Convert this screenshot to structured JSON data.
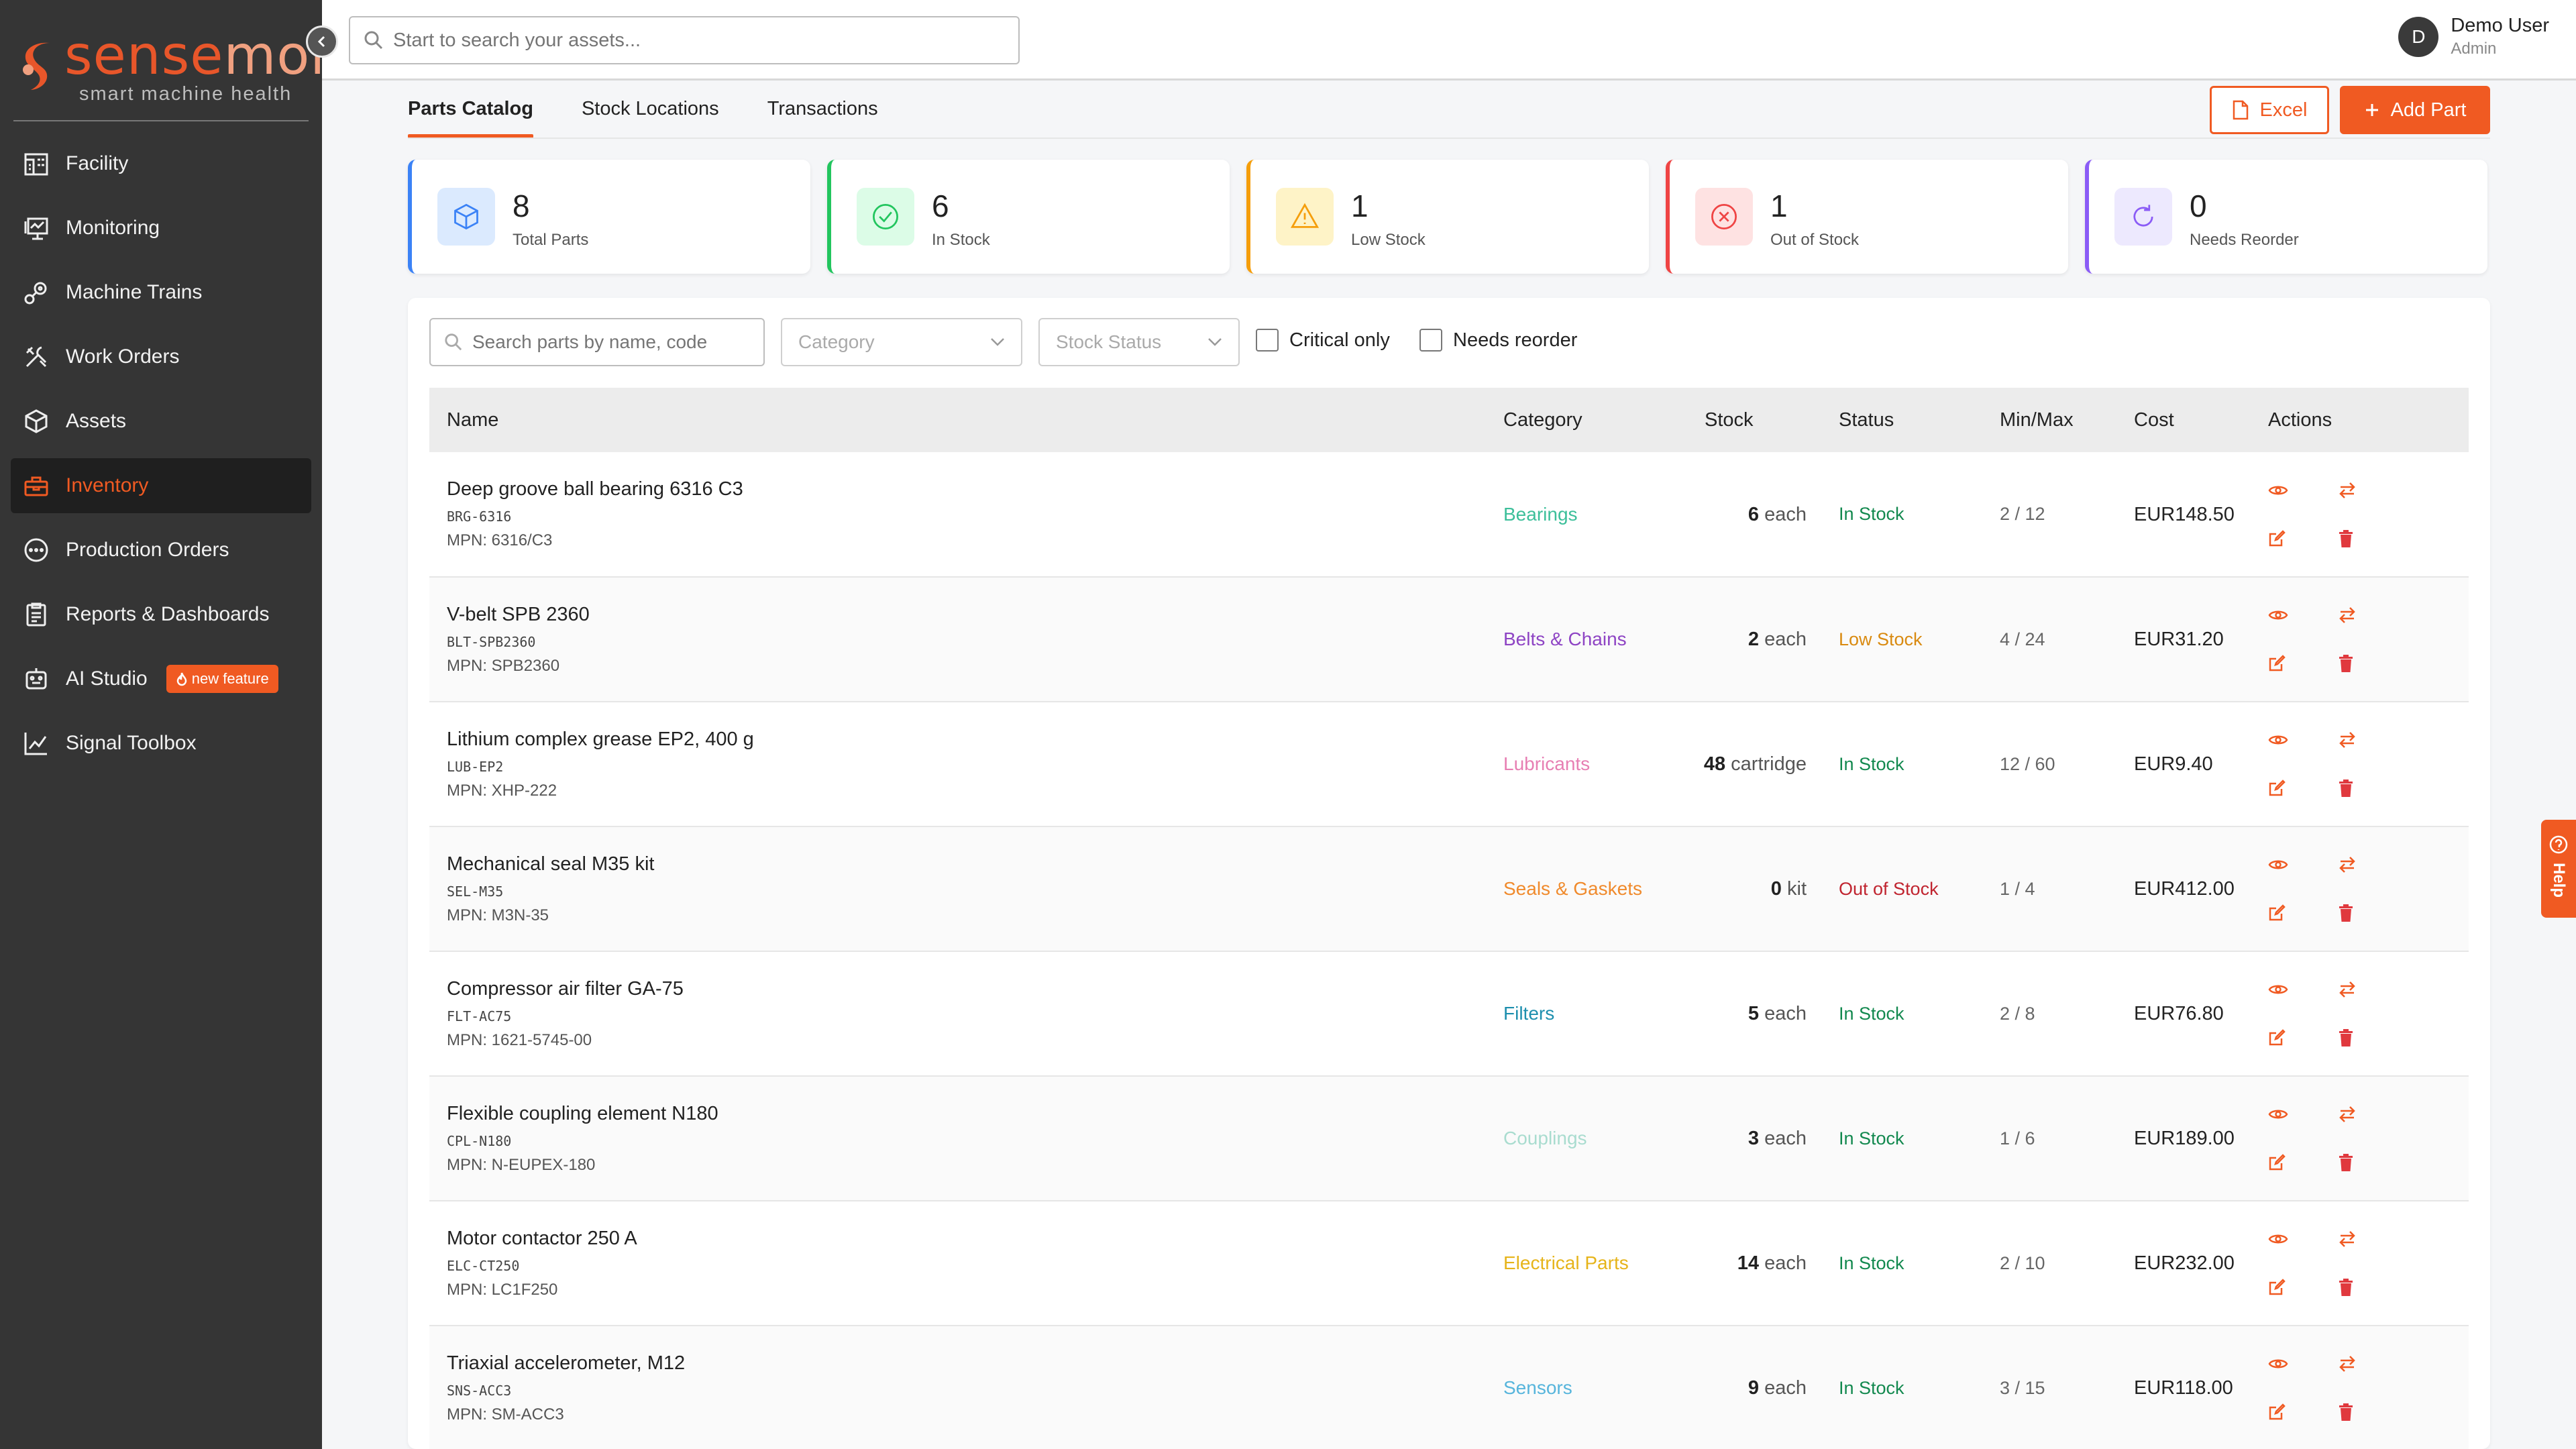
{
  "brand": {
    "word_a": "sense",
    "word_b": "more",
    "tagline": "smart machine health"
  },
  "search": {
    "placeholder": "Start to search your assets..."
  },
  "user": {
    "initial": "D",
    "name": "Demo User",
    "role": "Admin"
  },
  "sidebar": {
    "items": [
      {
        "label": "Facility",
        "icon": "building-icon"
      },
      {
        "label": "Monitoring",
        "icon": "monitor-icon"
      },
      {
        "label": "Machine Trains",
        "icon": "gears-icon"
      },
      {
        "label": "Work Orders",
        "icon": "tools-icon"
      },
      {
        "label": "Assets",
        "icon": "cube-icon"
      },
      {
        "label": "Inventory",
        "icon": "toolbox-icon",
        "active": true
      },
      {
        "label": "Production Orders",
        "icon": "dots-circle-icon"
      },
      {
        "label": "Reports & Dashboards",
        "icon": "clipboard-icon"
      },
      {
        "label": "AI Studio",
        "icon": "robot-icon",
        "badge": "new feature"
      },
      {
        "label": "Signal Toolbox",
        "icon": "chart-line-icon"
      }
    ]
  },
  "tabs": [
    {
      "label": "Parts Catalog",
      "active": true
    },
    {
      "label": "Stock Locations"
    },
    {
      "label": "Transactions"
    }
  ],
  "toolbar": {
    "excel_label": "Excel",
    "add_label": "Add Part"
  },
  "stats": [
    {
      "value": "8",
      "label": "Total Parts",
      "color": "#3b82f6"
    },
    {
      "value": "6",
      "label": "In Stock",
      "color": "#22c55e"
    },
    {
      "value": "1",
      "label": "Low Stock",
      "color": "#f59e0b"
    },
    {
      "value": "1",
      "label": "Out of Stock",
      "color": "#ef4444"
    },
    {
      "value": "0",
      "label": "Needs Reorder",
      "color": "#8b5cf6"
    }
  ],
  "filters": {
    "search_placeholder": "Search parts by name, code",
    "category_placeholder": "Category",
    "status_placeholder": "Stock Status",
    "critical_label": "Critical only",
    "reorder_label": "Needs reorder"
  },
  "table": {
    "headers": {
      "name": "Name",
      "category": "Category",
      "stock": "Stock",
      "status": "Status",
      "minmax": "Min/Max",
      "cost": "Cost",
      "actions": "Actions"
    },
    "rows": [
      {
        "name": "Deep groove ball bearing 6316 C3",
        "code": "BRG-6316",
        "mpn": "MPN: 6316/C3",
        "category": "Bearings",
        "category_color": "#3cbf9a",
        "stock_qty": "6",
        "stock_unit": "each",
        "status": "In Stock",
        "status_color": "#13894f",
        "minmax": "2 / 12",
        "cost": "EUR148.50"
      },
      {
        "name": "V-belt SPB 2360",
        "code": "BLT-SPB2360",
        "mpn": "MPN: SPB2360",
        "category": "Belts & Chains",
        "category_color": "#8e44c4",
        "stock_qty": "2",
        "stock_unit": "each",
        "status": "Low Stock",
        "status_color": "#d98a10",
        "minmax": "4 / 24",
        "cost": "EUR31.20"
      },
      {
        "name": "Lithium complex grease EP2, 400 g",
        "code": "LUB-EP2",
        "mpn": "MPN: XHP-222",
        "category": "Lubricants",
        "category_color": "#e77fb3",
        "stock_qty": "48",
        "stock_unit": "cartridge",
        "status": "In Stock",
        "status_color": "#13894f",
        "minmax": "12 / 60",
        "cost": "EUR9.40"
      },
      {
        "name": "Mechanical seal M35 kit",
        "code": "SEL-M35",
        "mpn": "MPN: M3N-35",
        "category": "Seals & Gaskets",
        "category_color": "#f08a2c",
        "stock_qty": "0",
        "stock_unit": "kit",
        "status": "Out of Stock",
        "status_color": "#c0242f",
        "minmax": "1 / 4",
        "cost": "EUR412.00"
      },
      {
        "name": "Compressor air filter GA-75",
        "code": "FLT-AC75",
        "mpn": "MPN: 1621-5745-00",
        "category": "Filters",
        "category_color": "#1d8fae",
        "stock_qty": "5",
        "stock_unit": "each",
        "status": "In Stock",
        "status_color": "#13894f",
        "minmax": "2 / 8",
        "cost": "EUR76.80"
      },
      {
        "name": "Flexible coupling element N180",
        "code": "CPL-N180",
        "mpn": "MPN: N-EUPEX-180",
        "category": "Couplings",
        "category_color": "#a9dccf",
        "stock_qty": "3",
        "stock_unit": "each",
        "status": "In Stock",
        "status_color": "#13894f",
        "minmax": "1 / 6",
        "cost": "EUR189.00"
      },
      {
        "name": "Motor contactor 250 A",
        "code": "ELC-CT250",
        "mpn": "MPN: LC1F250",
        "category": "Electrical Parts",
        "category_color": "#e6b41a",
        "stock_qty": "14",
        "stock_unit": "each",
        "status": "In Stock",
        "status_color": "#13894f",
        "minmax": "2 / 10",
        "cost": "EUR232.00"
      },
      {
        "name": "Triaxial accelerometer, M12",
        "code": "SNS-ACC3",
        "mpn": "MPN: SM-ACC3",
        "category": "Sensors",
        "category_color": "#57b5dc",
        "stock_qty": "9",
        "stock_unit": "each",
        "status": "In Stock",
        "status_color": "#13894f",
        "minmax": "3 / 15",
        "cost": "EUR118.00"
      }
    ]
  },
  "help": {
    "label": "Help"
  },
  "colors": {
    "accent": "#f05a22",
    "sidebar_bg": "#353535"
  }
}
